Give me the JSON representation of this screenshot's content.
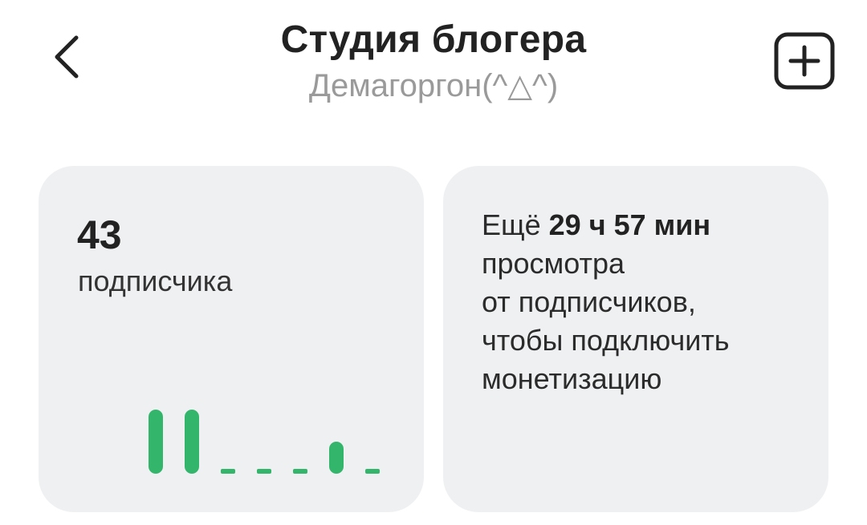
{
  "header": {
    "title": "Студия блогера",
    "subtitle": "Демагоргон(^△^)",
    "back_icon": "chevron-left-icon",
    "add_icon": "plus-square-icon"
  },
  "subscribers": {
    "count": "43",
    "label": "подписчика"
  },
  "monetization": {
    "prefix": "Ещё ",
    "time_remaining": "29 ч 57 мин",
    "line2": "просмотра",
    "line3": "от подписчиков,",
    "line4": "чтобы подключить",
    "line5": "монетизацию"
  },
  "colors": {
    "accent_green": "#33b66c",
    "card_bg": "#eff0f2",
    "title": "#222222",
    "subtitle": "#9a9a9a"
  },
  "chart_data": {
    "type": "bar",
    "categories": [
      "1",
      "2",
      "3",
      "4",
      "5",
      "6",
      "7"
    ],
    "values": [
      1,
      1,
      0,
      0,
      0,
      0.5,
      0
    ],
    "ylim": [
      0,
      1
    ],
    "grid": false
  }
}
